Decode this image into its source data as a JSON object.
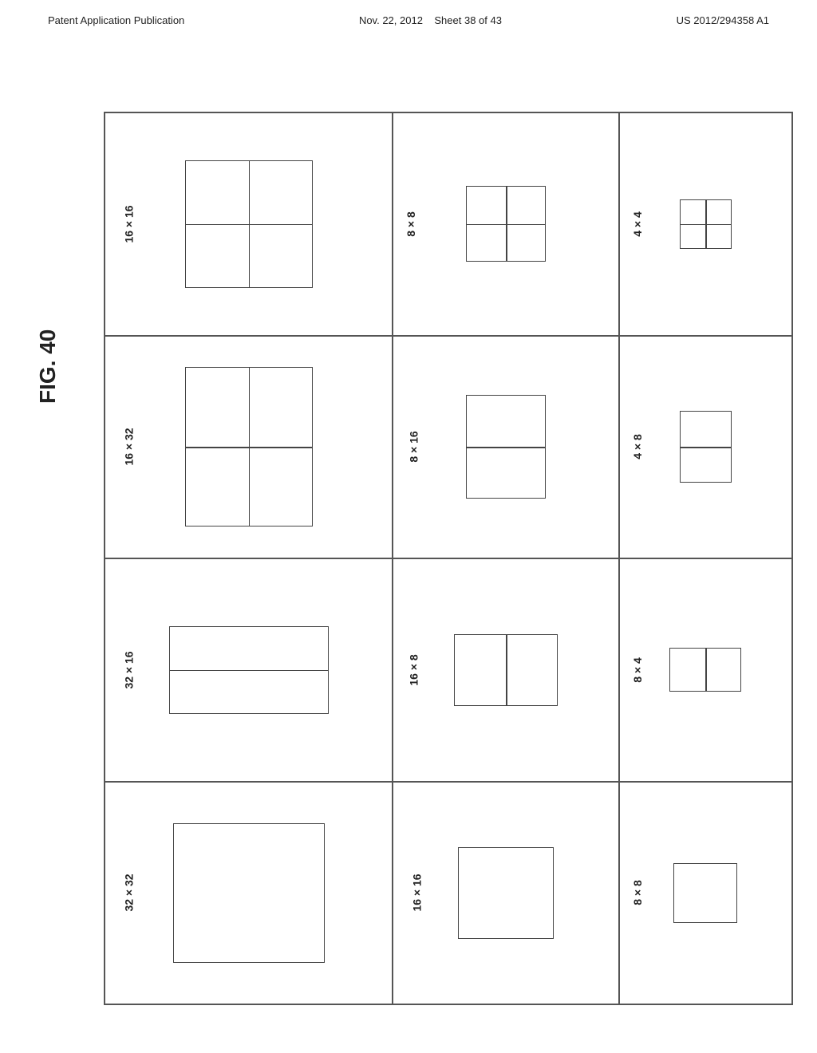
{
  "header": {
    "left": "Patent Application Publication",
    "center": "Nov. 22, 2012",
    "sheet": "Sheet 38 of 43",
    "right": "US 2012/294358 A1"
  },
  "figure": {
    "label": "FIG. 40"
  },
  "rows": [
    {
      "left_label": "16 × 16",
      "left_grid": {
        "h_lines": [
          0.5
        ],
        "v_lines": [
          0.5
        ]
      },
      "mid_label": "8 × 8",
      "mid_grid": {
        "h_lines": [
          0.5
        ],
        "v_lines": [
          0.5
        ]
      },
      "right_label": "4 × 4",
      "right_grid": {
        "h_lines": [
          0.5
        ],
        "v_lines": [
          0.5
        ]
      }
    },
    {
      "left_label": "16 × 32",
      "left_grid": {
        "h_lines": [
          0.5
        ],
        "v_lines": [
          0.5
        ]
      },
      "mid_label": "8 × 16",
      "mid_grid": {
        "h_lines": [
          0.5
        ],
        "v_lines": []
      },
      "right_label": "4 × 8",
      "right_grid": {
        "h_lines": [
          0.5
        ],
        "v_lines": []
      }
    },
    {
      "left_label": "32 × 16",
      "left_grid": {
        "h_lines": [
          0.5
        ],
        "v_lines": []
      },
      "mid_label": "16 × 8",
      "mid_grid": {
        "h_lines": [],
        "v_lines": [
          0.5
        ]
      },
      "right_label": "8 × 4",
      "right_grid": {
        "h_lines": [],
        "v_lines": [
          0.5
        ]
      }
    },
    {
      "left_label": "32 × 32",
      "left_grid": {
        "h_lines": [],
        "v_lines": []
      },
      "mid_label": "16 × 16",
      "mid_grid": {
        "h_lines": [],
        "v_lines": []
      },
      "right_label": "8 × 8",
      "right_grid": {
        "h_lines": [],
        "v_lines": []
      }
    }
  ]
}
